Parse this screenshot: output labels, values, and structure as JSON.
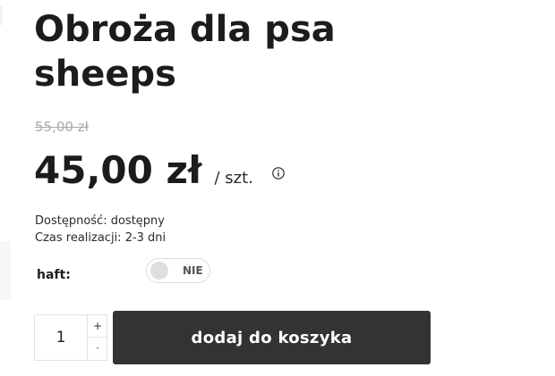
{
  "product": {
    "title": "Obroża dla psa sheeps",
    "old_price": "55,00 zł",
    "price": "45,00 zł",
    "unit": "/ szt.",
    "availability": "Dostępność: dostępny",
    "lead_time": "Czas realizacji: 2-3 dni"
  },
  "options": {
    "haft_label": "haft:",
    "haft_toggle_label": "NIE",
    "haft_enabled": false
  },
  "cart": {
    "quantity": "1",
    "plus_label": "+",
    "minus_label": "-",
    "add_button_label": "dodaj do koszyka"
  },
  "icons": {
    "info": "info-icon"
  },
  "colors": {
    "button_bg": "#333333",
    "old_price": "#a9a9a9",
    "text": "#1c1c1c"
  }
}
